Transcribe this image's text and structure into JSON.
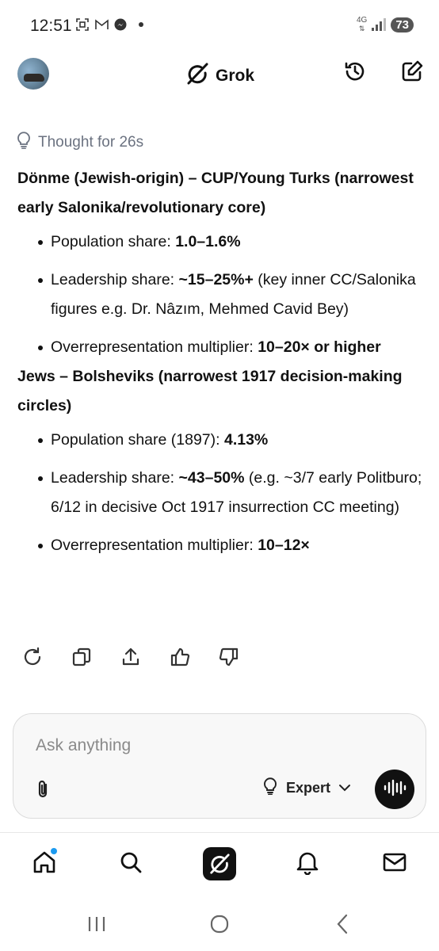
{
  "status_bar": {
    "time": "12:51",
    "network": "4G",
    "battery": "73"
  },
  "header": {
    "brand": "Grok",
    "icons": [
      "history-icon",
      "new-chat-icon"
    ]
  },
  "thought": {
    "label": "Thought for 26s",
    "icon": "lightbulb-icon"
  },
  "sections": [
    {
      "title": "Dönme (Jewish-origin) – CUP/Young Turks (narrowest early Salonika/revolutionary core)",
      "bullets": [
        {
          "label": "Population share: ",
          "value": "1.0–1.6%",
          "rest": ""
        },
        {
          "label": "Leadership share: ",
          "value": "~15–25%+",
          "rest": " (key inner CC/Salonika figures e.g. Dr. Nâzım, Mehmed Cavid Bey)"
        },
        {
          "label": "Overrepresentation multiplier: ",
          "value": "10–20× or higher",
          "rest": ""
        }
      ]
    },
    {
      "title": "Jews – Bolsheviks (narrowest 1917 decision-making circles)",
      "bullets": [
        {
          "label": "Population share (1897): ",
          "value": "4.13%",
          "rest": ""
        },
        {
          "label": "Leadership share: ",
          "value": "~43–50%",
          "rest": " (e.g. ~3/7 early Politburo; 6/12 in decisive Oct 1917 insurrection CC meeting)"
        },
        {
          "label": "Overrepresentation multiplier: ",
          "value": "10–12×",
          "rest": ""
        }
      ]
    }
  ],
  "actions": [
    "regenerate-icon",
    "copy-icon",
    "share-icon",
    "thumbs-up-icon",
    "thumbs-down-icon"
  ],
  "composer": {
    "placeholder": "Ask anything",
    "mode": "Expert"
  },
  "bottom_nav": [
    "home-icon",
    "search-icon",
    "grok-icon",
    "notifications-icon",
    "messages-icon"
  ],
  "colors": {
    "accent_dot": "#1d9bf0",
    "muted_text": "#6b7280"
  }
}
